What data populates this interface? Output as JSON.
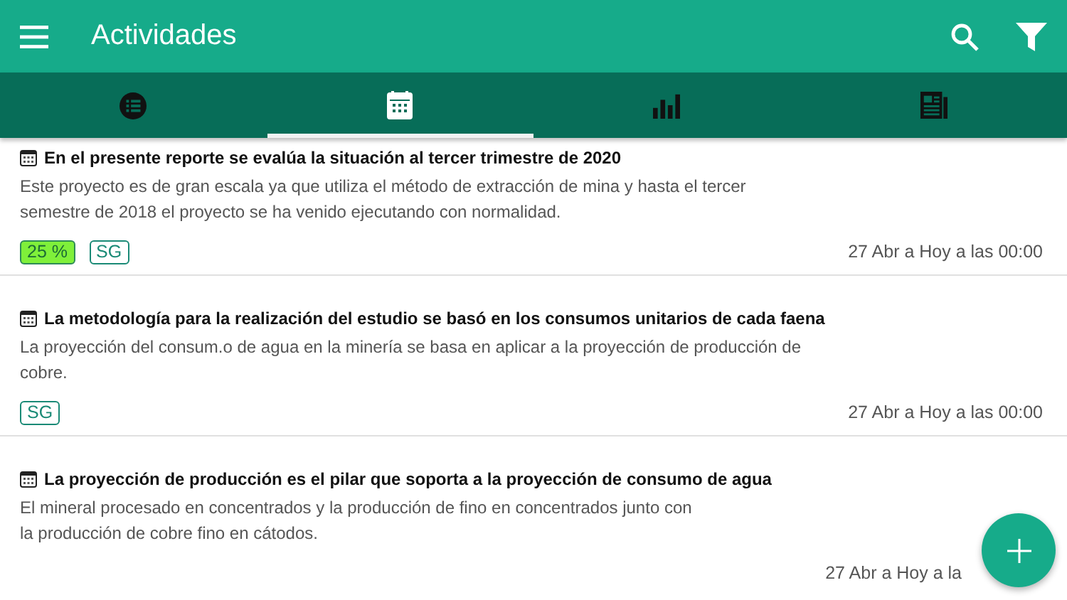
{
  "app_bar": {
    "title": "Actividades"
  },
  "tabs": [
    {
      "kind": "list",
      "selected": false
    },
    {
      "kind": "calendar",
      "selected": true
    },
    {
      "kind": "chart",
      "selected": false
    },
    {
      "kind": "news",
      "selected": false
    }
  ],
  "activities": [
    {
      "title": "En el presente reporte se evalúa la situación al tercer trimestre de 2020",
      "description_lines": [
        "Este proyecto es de gran escala ya que utiliza el método de extracción de mina y hasta el tercer",
        "semestre de 2018 el proyecto se ha venido ejecutando con normalidad."
      ],
      "tags": [
        {
          "kind": "percent",
          "label": "25 %"
        },
        {
          "kind": "code",
          "label": "SG"
        }
      ],
      "date": "27 Abr a Hoy a las 00:00"
    },
    {
      "title": "La metodología para la realización del estudio se basó en los consumos unitarios de cada faena",
      "description_lines": [
        "La proyección del consum.o de agua en la minería se basa en aplicar a la proyección de producción de",
        "cobre."
      ],
      "tags": [
        {
          "kind": "code",
          "label": "SG"
        }
      ],
      "date": "27 Abr a Hoy a las 00:00"
    },
    {
      "title": "La proyección de producción es el pilar que soporta a la proyección de consumo de agua",
      "description_lines": [
        "El mineral procesado en concentrados y la producción de fino en concentrados junto con",
        "la producción de cobre fino en cátodos."
      ],
      "date": "27 Abr a Hoy a la"
    }
  ]
}
